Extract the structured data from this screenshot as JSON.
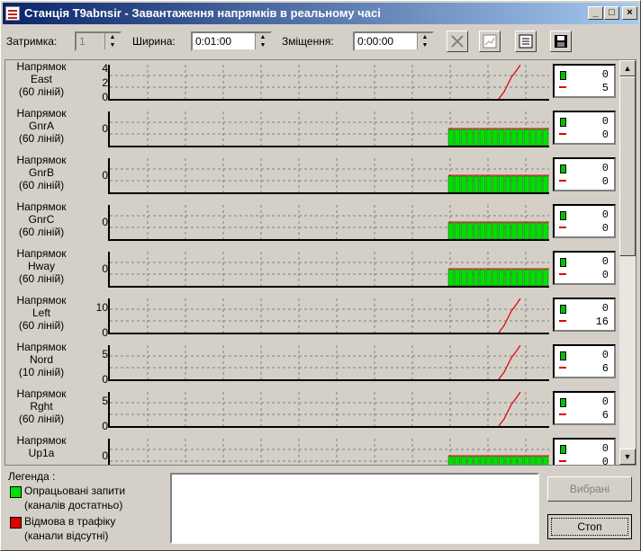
{
  "window": {
    "title": "Станція T9abnsir - Завантаження напрямків в реальному часі",
    "minimize": "_",
    "maximize": "□",
    "close": "×"
  },
  "toolbar": {
    "delay_label": "Затримка:",
    "delay_value": "1",
    "width_label": "Ширина:",
    "width_value": "0:01:00",
    "offset_label": "Зміщення:",
    "offset_value": "0:00:00"
  },
  "rows": [
    {
      "l1": "Напрямок",
      "l2": "East",
      "l3": "(60 ліній)",
      "ticks": [
        "4",
        "2",
        "0"
      ],
      "v1": "0",
      "v2": "5",
      "kind": "line"
    },
    {
      "l1": "Напрямок",
      "l2": "GnrA",
      "l3": "(60 ліній)",
      "ticks": [
        "0"
      ],
      "v1": "0",
      "v2": "0",
      "kind": "bars"
    },
    {
      "l1": "Напрямок",
      "l2": "GnrB",
      "l3": "(60 ліній)",
      "ticks": [
        "0"
      ],
      "v1": "0",
      "v2": "0",
      "kind": "bars"
    },
    {
      "l1": "Напрямок",
      "l2": "GnrC",
      "l3": "(60 ліній)",
      "ticks": [
        "0"
      ],
      "v1": "0",
      "v2": "0",
      "kind": "bars"
    },
    {
      "l1": "Напрямок",
      "l2": "Hway",
      "l3": "(60 ліній)",
      "ticks": [
        "0"
      ],
      "v1": "0",
      "v2": "0",
      "kind": "bars"
    },
    {
      "l1": "Напрямок",
      "l2": "Left",
      "l3": "(60 ліній)",
      "ticks": [
        "10",
        "0"
      ],
      "v1": "0",
      "v2": "16",
      "kind": "line"
    },
    {
      "l1": "Напрямок",
      "l2": "Nord",
      "l3": "(10 ліній)",
      "ticks": [
        "5",
        "0"
      ],
      "v1": "0",
      "v2": "6",
      "kind": "line"
    },
    {
      "l1": "Напрямок",
      "l2": "Rght",
      "l3": "(60 ліній)",
      "ticks": [
        "5",
        "0"
      ],
      "v1": "0",
      "v2": "6",
      "kind": "line"
    },
    {
      "l1": "Напрямок",
      "l2": "Up1a",
      "l3": "",
      "ticks": [
        "0"
      ],
      "v1": "0",
      "v2": "0",
      "kind": "bars"
    }
  ],
  "legend": {
    "title": "Легенда :",
    "ok_1": "Опрацьовані запити",
    "ok_2": "(каналів достатньо)",
    "fail_1": "Відмова в трафіку",
    "fail_2": "(канали відсутні)",
    "ok_color": "#00e000",
    "fail_color": "#e00000"
  },
  "buttons": {
    "selected": "Вибрані",
    "stop": "Стоп"
  }
}
